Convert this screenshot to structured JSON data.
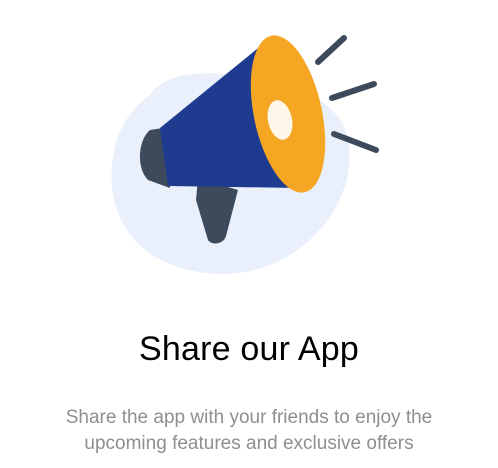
{
  "share_card": {
    "illustration": {
      "icon": "megaphone-icon",
      "colors": {
        "blob": "#e9f0fb",
        "body": "#1f3b8f",
        "bell": "#f5a623",
        "handle": "#3d4a5c",
        "sound_lines": "#3d4a5c",
        "highlight": "#ffffff"
      }
    },
    "title": "Share our App",
    "subtitle": "Share the app with your friends to enjoy the upcoming features and exclusive offers"
  }
}
